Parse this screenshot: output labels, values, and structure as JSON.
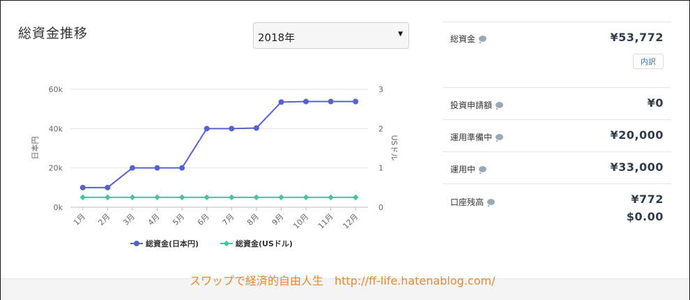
{
  "header": {
    "title": "総資金推移"
  },
  "year_select": {
    "selected": "2018年",
    "caret": "▼"
  },
  "chart_data": {
    "type": "line",
    "categories": [
      "1月",
      "2月",
      "3月",
      "4月",
      "5月",
      "6月",
      "7月",
      "8月",
      "9月",
      "10月",
      "11月",
      "12月"
    ],
    "series": [
      {
        "name": "総資金(日本円)",
        "axis": "left",
        "color": "#5561d4",
        "values": [
          10000,
          10000,
          20000,
          20000,
          20000,
          40000,
          40000,
          40300,
          53500,
          53772,
          53772,
          53772
        ]
      },
      {
        "name": "総資金(USドル)",
        "axis": "right",
        "color": "#3cc9a0",
        "values": [
          0.25,
          0.25,
          0.25,
          0.25,
          0.25,
          0.25,
          0.25,
          0.25,
          0.25,
          0.25,
          0.25,
          0.25
        ]
      }
    ],
    "ylabel": "日本円",
    "y2label": "USドル",
    "ylim": [
      0,
      60000
    ],
    "y2lim": [
      0,
      3
    ],
    "yticks": [
      "0k",
      "20k",
      "40k",
      "60k"
    ],
    "y2ticks": [
      "0",
      "1",
      "2",
      "3"
    ],
    "grid": true,
    "legend": "bottom"
  },
  "summary": {
    "total": {
      "label": "総資金",
      "value": "¥53,772",
      "button": "内訳"
    },
    "pending": {
      "label": "投資申請額",
      "value": "¥0"
    },
    "preparing": {
      "label": "運用準備中",
      "value": "¥20,000"
    },
    "operating": {
      "label": "運用中",
      "value": "¥33,000"
    },
    "balance": {
      "label": "口座残高",
      "value_jpy": "¥772",
      "value_usd": "$0.00"
    }
  },
  "watermark": {
    "text": "スワップで経済的自由人生　http://ff-life.hatenablog.com/"
  },
  "colors": {
    "jpy_series": "#5561d4",
    "usd_series": "#3cc9a0",
    "watermark": "#e8892b"
  }
}
